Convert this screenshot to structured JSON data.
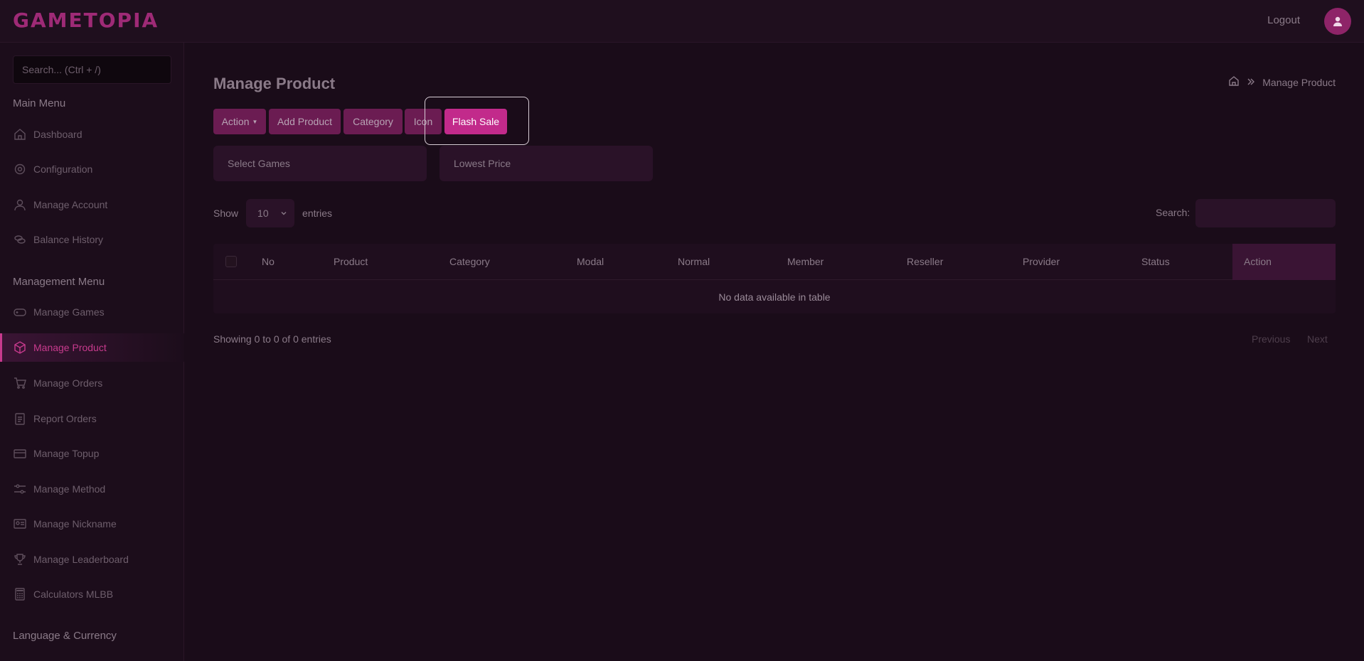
{
  "app": {
    "logo": "GAMETOPIA",
    "logout": "Logout"
  },
  "sidebar": {
    "search_placeholder": "Search... (Ctrl + /)",
    "main_heading": "Main Menu",
    "main_items": [
      "Dashboard",
      "Configuration",
      "Manage Account",
      "Balance History"
    ],
    "mgmt_heading": "Management Menu",
    "mgmt_items": [
      "Manage Games",
      "Manage Product",
      "Manage Orders",
      "Report Orders",
      "Manage Topup",
      "Manage Method",
      "Manage Nickname",
      "Manage Leaderboard",
      "Calculators MLBB"
    ],
    "lang_heading": "Language & Currency",
    "active": "Manage Product"
  },
  "page": {
    "title": "Manage Product",
    "breadcrumb": "Manage Product"
  },
  "toolbar": {
    "action": "Action",
    "add_product": "Add Product",
    "category": "Category",
    "icon": "Icon",
    "flash_sale": "Flash Sale"
  },
  "filters": {
    "games": "Select Games",
    "price": "Lowest Price"
  },
  "table_controls": {
    "show": "Show",
    "length": "10",
    "entries": "entries",
    "search_label": "Search:"
  },
  "table": {
    "headers": [
      "No",
      "Product",
      "Category",
      "Modal",
      "Normal",
      "Member",
      "Reseller",
      "Provider",
      "Status",
      "Action"
    ],
    "empty": "No data available in table",
    "info": "Showing 0 to 0 of 0 entries",
    "previous": "Previous",
    "next": "Next"
  },
  "colors": {
    "accent": "#c22a8b",
    "button": "#6b1c52",
    "background": "#1a0c19"
  }
}
